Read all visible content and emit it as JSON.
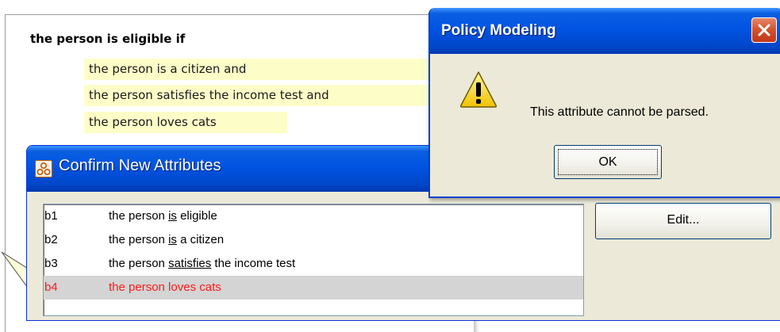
{
  "rule": {
    "heading": "the person is eligible if",
    "conditions": [
      "the person is a citizen and",
      "the person satisfies the income test and",
      "the person loves cats"
    ]
  },
  "confirm_window": {
    "title": "Confirm New Attributes",
    "attributes": [
      {
        "code": "b1",
        "pre": "the person ",
        "verb": "is",
        "post": " eligible"
      },
      {
        "code": "b2",
        "pre": "the person ",
        "verb": "is",
        "post": " a citizen"
      },
      {
        "code": "b3",
        "pre": "the person ",
        "verb": "satisfies",
        "post": " the income test"
      },
      {
        "code": "b4",
        "pre": "the person loves cats",
        "verb": "",
        "post": ""
      }
    ],
    "edit_label": "Edit..."
  },
  "message_box": {
    "title": "Policy Modeling",
    "message": "This attribute cannot be parsed.",
    "ok_label": "OK"
  },
  "colors": {
    "title_bar": "#0054e3",
    "error_text": "#ff1a1a",
    "highlight": "#fdfdc8",
    "dialog_bg": "#ece9d8"
  },
  "icons": {
    "message_icon": "warning-icon",
    "window_icon": "app-icon",
    "close": "close-icon"
  }
}
